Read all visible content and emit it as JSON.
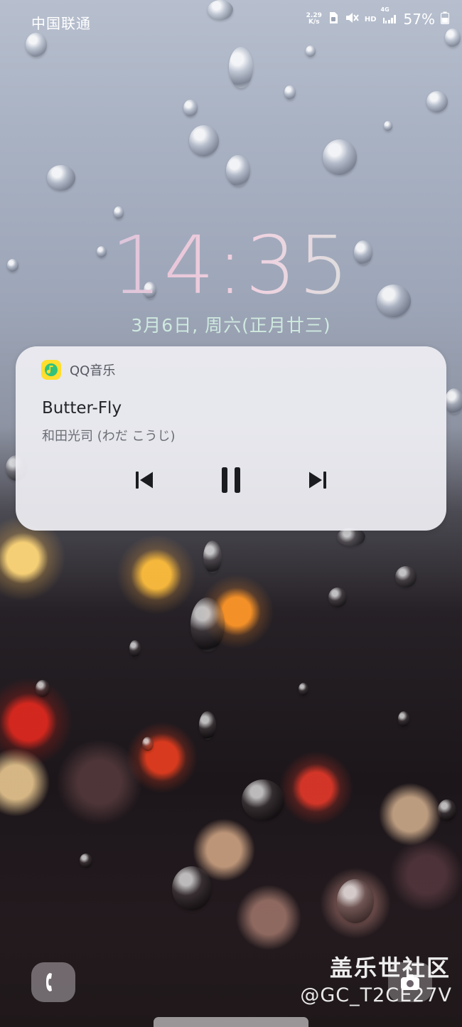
{
  "status_bar": {
    "carrier": "中国联通",
    "net_speed_value": "2.29",
    "net_speed_unit": "K/s",
    "hd": "HD",
    "network_type": "4G",
    "battery_percent": "57%",
    "icons": [
      "sim-icon",
      "mute-icon",
      "signal-icon",
      "battery-icon"
    ]
  },
  "lock_screen": {
    "time": "14:35",
    "date": "3月6日, 周六(正月廿三)"
  },
  "media_card": {
    "app_name": "QQ音乐",
    "app_color": "#ffde2e",
    "title": "Butter-Fly",
    "artist": "和田光司 (わだ こうじ)",
    "controls": [
      "previous-icon",
      "pause-icon",
      "next-icon"
    ]
  },
  "shortcuts": {
    "left": "phone-icon",
    "right": "camera-icon"
  },
  "watermark": {
    "line1": "盖乐世社区",
    "line2": "@GC_T2CE27V"
  }
}
